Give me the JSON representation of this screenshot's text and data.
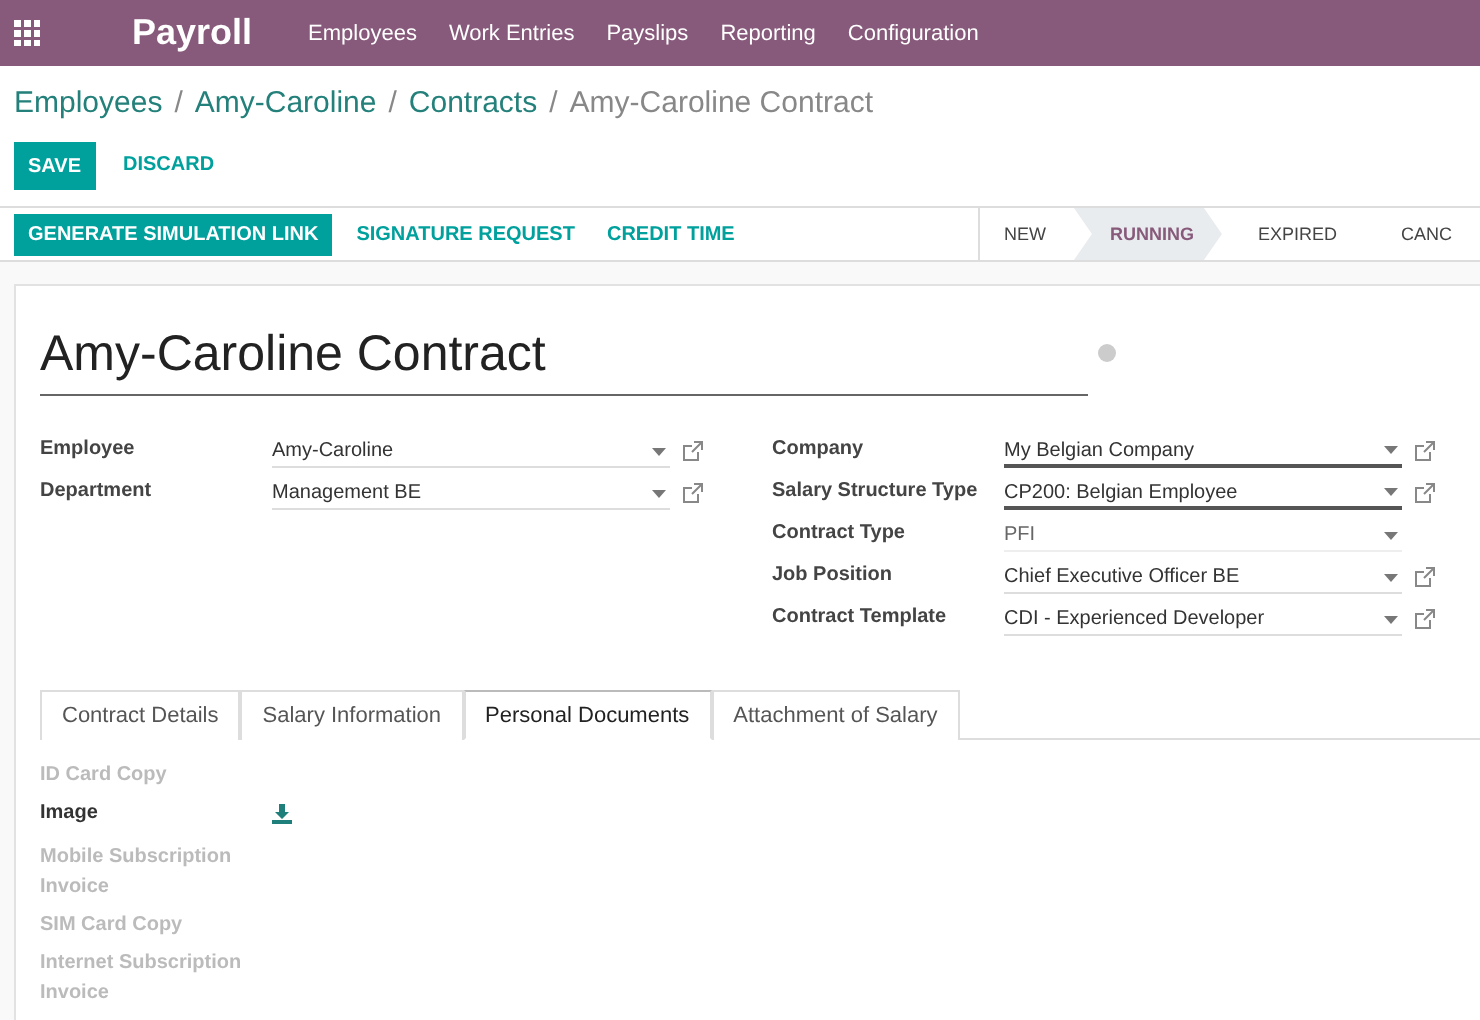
{
  "app": {
    "name": "Payroll",
    "menu": [
      "Employees",
      "Work Entries",
      "Payslips",
      "Reporting",
      "Configuration"
    ]
  },
  "breadcrumb": [
    {
      "label": "Employees",
      "separator": "/"
    },
    {
      "label": "Amy-Caroline",
      "separator": "/"
    },
    {
      "label": "Contracts",
      "separator": "/"
    }
  ],
  "breadcrumb_current": "Amy-Caroline Contract",
  "form_buttons": {
    "save": "SAVE",
    "discard": "DISCARD"
  },
  "header_buttons": [
    {
      "label": "GENERATE SIMULATION LINK",
      "primary": true
    },
    {
      "label": "SIGNATURE REQUEST",
      "primary": false
    },
    {
      "label": "CREDIT TIME",
      "primary": false
    }
  ],
  "stages": [
    {
      "label": "NEW",
      "selected": false
    },
    {
      "label": "RUNNING",
      "selected": true
    },
    {
      "label": "EXPIRED",
      "selected": false
    },
    {
      "label": "CANC",
      "selected": false
    }
  ],
  "title": "Amy-Caroline Contract",
  "left_fields": [
    {
      "label": "Employee",
      "value": "Amy-Caroline",
      "required": false,
      "readonly": false,
      "link": true
    },
    {
      "label": "Department",
      "value": "Management BE",
      "required": false,
      "readonly": false,
      "link": true
    }
  ],
  "right_fields": [
    {
      "label": "Company",
      "value": "My Belgian Company",
      "required": true,
      "readonly": false,
      "link": true
    },
    {
      "label": "Salary Structure Type",
      "value": "CP200: Belgian Employee",
      "required": true,
      "readonly": false,
      "link": true
    },
    {
      "label": "Contract Type",
      "value": "PFI",
      "required": false,
      "readonly": true,
      "link": false
    },
    {
      "label": "Job Position",
      "value": "Chief Executive Officer BE",
      "required": false,
      "readonly": false,
      "link": true
    },
    {
      "label": "Contract Template",
      "value": "CDI - Experienced Developer",
      "required": false,
      "readonly": false,
      "link": true
    }
  ],
  "tabs": [
    {
      "label": "Contract Details",
      "selected": false
    },
    {
      "label": "Salary Information",
      "selected": false
    },
    {
      "label": "Personal Documents",
      "selected": true
    },
    {
      "label": "Attachment of Salary",
      "selected": false
    }
  ],
  "documents": [
    {
      "label": "ID Card Copy",
      "empty": true
    },
    {
      "label": "Image",
      "empty": false
    },
    {
      "label": "Mobile Subscription Invoice",
      "empty": true
    },
    {
      "label": "SIM Card Copy",
      "empty": true
    },
    {
      "label": "Internet Subscription Invoice",
      "empty": true
    }
  ]
}
